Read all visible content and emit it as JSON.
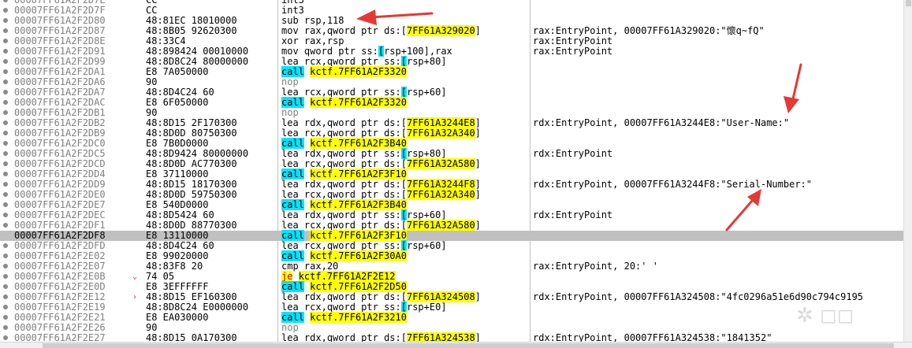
{
  "colors": {
    "call_highlight": "#00e5ff",
    "jump_highlight": "#ffff00",
    "selected_row": "#c0c0c0",
    "arrow": "#e53935"
  },
  "icons": {
    "row_marker": "breakpoint-dot-icon",
    "jump_indicator": "jump-arrow-icon",
    "annotation": "red-arrow-icon"
  },
  "rows": [
    {
      "addr": "00007FF61A2F2D7E",
      "bytes": "CC",
      "mn": "int3",
      "ops": [],
      "cmt": "",
      "dot": true
    },
    {
      "addr": "00007FF61A2F2D7F",
      "bytes": "CC",
      "mn": "int3",
      "ops": [],
      "cmt": "",
      "dot": true
    },
    {
      "addr": "00007FF61A2F2D80",
      "bytes": "48:81EC 18010000",
      "mn": "sub",
      "ops": [
        {
          "t": "rsp,118"
        }
      ],
      "cmt": "",
      "dot": true
    },
    {
      "addr": "00007FF61A2F2D87",
      "bytes": "48:8B05 92620300",
      "mn": "mov",
      "ops": [
        {
          "t": "rax,qword ptr ds:["
        },
        {
          "t": "7FF61A329020",
          "c": "tgt"
        },
        {
          "t": "]"
        }
      ],
      "cmt": "rax:EntryPoint, 00007FF61A329020:\"懷q~fQ\"",
      "dot": true
    },
    {
      "addr": "00007FF61A2F2D8E",
      "bytes": "48:33C4",
      "mn": "xor",
      "ops": [
        {
          "t": "rax,rsp"
        }
      ],
      "cmt": "rax:EntryPoint",
      "dot": true
    },
    {
      "addr": "00007FF61A2F2D91",
      "bytes": "48:898424 00010000",
      "mn": "mov",
      "ops": [
        {
          "t": "qword ptr ss:"
        },
        {
          "t": "[",
          "c": "brk"
        },
        {
          "t": "rsp+100],rax"
        }
      ],
      "cmt": "rax:EntryPoint",
      "dot": true
    },
    {
      "addr": "00007FF61A2F2D99",
      "bytes": "48:8D8C24 80000000",
      "mn": "lea",
      "ops": [
        {
          "t": "rcx,qword ptr ss:"
        },
        {
          "t": "[",
          "c": "brk"
        },
        {
          "t": "rsp+80]"
        }
      ],
      "cmt": "",
      "dot": true
    },
    {
      "addr": "00007FF61A2F2DA1",
      "bytes": "E8 7A050000",
      "mn": "call",
      "mnc": "call",
      "ops": [
        {
          "t": "kctf.7FF61A2F3320",
          "c": "tgt"
        }
      ],
      "cmt": "",
      "dot": true
    },
    {
      "addr": "00007FF61A2F2DA6",
      "bytes": "90",
      "mn": "nop",
      "mnc": "nop",
      "ops": [],
      "cmt": "",
      "dot": true
    },
    {
      "addr": "00007FF61A2F2DA7",
      "bytes": "48:8D4C24 60",
      "mn": "lea",
      "ops": [
        {
          "t": "rcx,qword ptr ss:"
        },
        {
          "t": "[",
          "c": "brk"
        },
        {
          "t": "rsp+60]"
        }
      ],
      "cmt": "",
      "dot": true
    },
    {
      "addr": "00007FF61A2F2DAC",
      "bytes": "E8 6F050000",
      "mn": "call",
      "mnc": "call",
      "ops": [
        {
          "t": "kctf.7FF61A2F3320",
          "c": "tgt"
        }
      ],
      "cmt": "",
      "dot": true
    },
    {
      "addr": "00007FF61A2F2DB1",
      "bytes": "90",
      "mn": "nop",
      "mnc": "nop",
      "ops": [],
      "cmt": "",
      "dot": true
    },
    {
      "addr": "00007FF61A2F2DB2",
      "bytes": "48:8D15 2F170300",
      "mn": "lea",
      "ops": [
        {
          "t": "rdx,qword ptr ds:["
        },
        {
          "t": "7FF61A3244E8",
          "c": "tgt"
        },
        {
          "t": "]"
        }
      ],
      "cmt": "rdx:EntryPoint, 00007FF61A3244E8:\"User-Name:\"",
      "dot": true
    },
    {
      "addr": "00007FF61A2F2DB9",
      "bytes": "48:8D0D 80750300",
      "mn": "lea",
      "ops": [
        {
          "t": "rcx,qword ptr ds:["
        },
        {
          "t": "7FF61A32A340",
          "c": "tgt"
        },
        {
          "t": "]"
        }
      ],
      "cmt": "",
      "dot": true
    },
    {
      "addr": "00007FF61A2F2DC0",
      "bytes": "E8 7B0D0000",
      "mn": "call",
      "mnc": "call",
      "ops": [
        {
          "t": "kctf.7FF61A2F3B40",
          "c": "tgt"
        }
      ],
      "cmt": "",
      "dot": true
    },
    {
      "addr": "00007FF61A2F2DC5",
      "bytes": "48:8D9424 80000000",
      "mn": "lea",
      "ops": [
        {
          "t": "rdx,qword ptr ss:"
        },
        {
          "t": "[",
          "c": "brk"
        },
        {
          "t": "rsp+80]"
        }
      ],
      "cmt": "rdx:EntryPoint",
      "dot": true
    },
    {
      "addr": "00007FF61A2F2DCD",
      "bytes": "48:8D0D AC770300",
      "mn": "lea",
      "ops": [
        {
          "t": "rcx,qword ptr ds:["
        },
        {
          "t": "7FF61A32A580",
          "c": "tgt"
        },
        {
          "t": "]"
        }
      ],
      "cmt": "",
      "dot": true
    },
    {
      "addr": "00007FF61A2F2DD4",
      "bytes": "E8 37110000",
      "mn": "call",
      "mnc": "call",
      "ops": [
        {
          "t": "kctf.7FF61A2F3F10",
          "c": "tgt"
        }
      ],
      "cmt": "",
      "dot": true
    },
    {
      "addr": "00007FF61A2F2DD9",
      "bytes": "48:8D15 18170300",
      "mn": "lea",
      "ops": [
        {
          "t": "rdx,qword ptr ds:["
        },
        {
          "t": "7FF61A3244F8",
          "c": "tgt"
        },
        {
          "t": "]"
        }
      ],
      "cmt": "rdx:EntryPoint, 00007FF61A3244F8:\"Serial-Number:\"",
      "dot": true
    },
    {
      "addr": "00007FF61A2F2DE0",
      "bytes": "48:8D0D 59750300",
      "mn": "lea",
      "ops": [
        {
          "t": "rcx,qword ptr ds:["
        },
        {
          "t": "7FF61A32A340",
          "c": "tgt"
        },
        {
          "t": "]"
        }
      ],
      "cmt": "",
      "dot": true
    },
    {
      "addr": "00007FF61A2F2DE7",
      "bytes": "E8 540D0000",
      "mn": "call",
      "mnc": "call",
      "ops": [
        {
          "t": "kctf.7FF61A2F3B40",
          "c": "tgt"
        }
      ],
      "cmt": "",
      "dot": true
    },
    {
      "addr": "00007FF61A2F2DEC",
      "bytes": "48:8D5424 60",
      "mn": "lea",
      "ops": [
        {
          "t": "rdx,qword ptr ss:"
        },
        {
          "t": "[",
          "c": "brk"
        },
        {
          "t": "rsp+60]"
        }
      ],
      "cmt": "rdx:EntryPoint",
      "dot": true
    },
    {
      "addr": "00007FF61A2F2DF1",
      "bytes": "48:8D0D 88770300",
      "mn": "lea",
      "ops": [
        {
          "t": "rcx,qword ptr ds:["
        },
        {
          "t": "7FF61A32A580",
          "c": "tgt"
        },
        {
          "t": "]"
        }
      ],
      "cmt": "",
      "dot": true
    },
    {
      "addr": "00007FF61A2F2DF8",
      "bytes": "E8 13110000",
      "mn": "call",
      "mnc": "call",
      "ops": [
        {
          "t": "kctf.7FF61A2F3F10",
          "c": "tgt"
        }
      ],
      "cmt": "",
      "dot": false,
      "selected": true
    },
    {
      "addr": "00007FF61A2F2DFD",
      "bytes": "48:8D4C24 60",
      "mn": "lea",
      "ops": [
        {
          "t": "rcx,qword ptr ss:"
        },
        {
          "t": "[",
          "c": "brk"
        },
        {
          "t": "rsp+60]"
        }
      ],
      "cmt": "",
      "dot": true
    },
    {
      "addr": "00007FF61A2F2E02",
      "bytes": "E8 99020000",
      "mn": "call",
      "mnc": "call",
      "ops": [
        {
          "t": "kctf.7FF61A2F30A0",
          "c": "tgt"
        }
      ],
      "cmt": "",
      "dot": true
    },
    {
      "addr": "00007FF61A2F2E07",
      "bytes": "48:83F8 20",
      "mn": "cmp",
      "ops": [
        {
          "t": "rax,20"
        }
      ],
      "cmt": "rax:EntryPoint, 20:' '",
      "dot": true
    },
    {
      "addr": "00007FF61A2F2E0B",
      "bytes": "74 05",
      "mn": "je",
      "mnc": "je",
      "ops": [
        {
          "t": "kctf.7FF61A2F2E12",
          "c": "tgt"
        }
      ],
      "cmt": "",
      "dot": true,
      "jmp": "v"
    },
    {
      "addr": "00007FF61A2F2E0D",
      "bytes": "E8 3EFFFFFF",
      "mn": "call",
      "mnc": "call",
      "ops": [
        {
          "t": "kctf.7FF61A2F2D50",
          "c": "tgt"
        }
      ],
      "cmt": "",
      "dot": true
    },
    {
      "addr": "00007FF61A2F2E12",
      "bytes": "48:8D15 EF160300",
      "mn": "lea",
      "ops": [
        {
          "t": "rdx,qword ptr ds:["
        },
        {
          "t": "7FF61A324508",
          "c": "tgt"
        },
        {
          "t": "]"
        }
      ],
      "cmt": "rdx:EntryPoint, 00007FF61A324508:\"4fc0296a51e6d90c794c9195",
      "dot": true,
      "jmp": ">"
    },
    {
      "addr": "00007FF61A2F2E19",
      "bytes": "48:8D8C24 E0000000",
      "mn": "lea",
      "ops": [
        {
          "t": "rcx,qword ptr ss:"
        },
        {
          "t": "[",
          "c": "brk"
        },
        {
          "t": "rsp+E0]"
        }
      ],
      "cmt": "",
      "dot": true
    },
    {
      "addr": "00007FF61A2F2E21",
      "bytes": "E8 EA030000",
      "mn": "call",
      "mnc": "call",
      "ops": [
        {
          "t": "kctf.7FF61A2F3210",
          "c": "tgt"
        }
      ],
      "cmt": "",
      "dot": true
    },
    {
      "addr": "00007FF61A2F2E26",
      "bytes": "90",
      "mn": "nop",
      "mnc": "nop",
      "ops": [],
      "cmt": "",
      "dot": true
    },
    {
      "addr": "00007FF61A2F2E27",
      "bytes": "48:8D15 0A170300",
      "mn": "lea",
      "ops": [
        {
          "t": "rdx,qword ptr ds:["
        },
        {
          "t": "7FF61A324538",
          "c": "tgt"
        },
        {
          "t": "]"
        }
      ],
      "cmt": "rdx:EntryPoint, 00007FF61A324538:\"1841352\"",
      "dot": true
    }
  ]
}
